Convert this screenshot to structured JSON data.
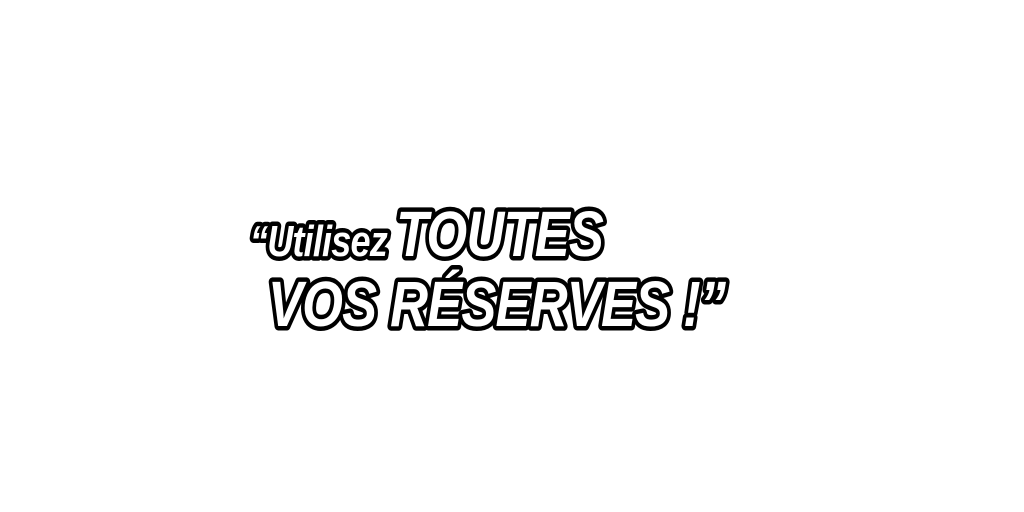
{
  "quote": {
    "line1_prefix": "“Utilisez ",
    "line1_emphasis": "TOUTES",
    "line2": "VOS RÉSERVES !”"
  },
  "colors": {
    "background": "#ffffff",
    "text_fill": "#ffffff",
    "text_outline": "#000000"
  }
}
